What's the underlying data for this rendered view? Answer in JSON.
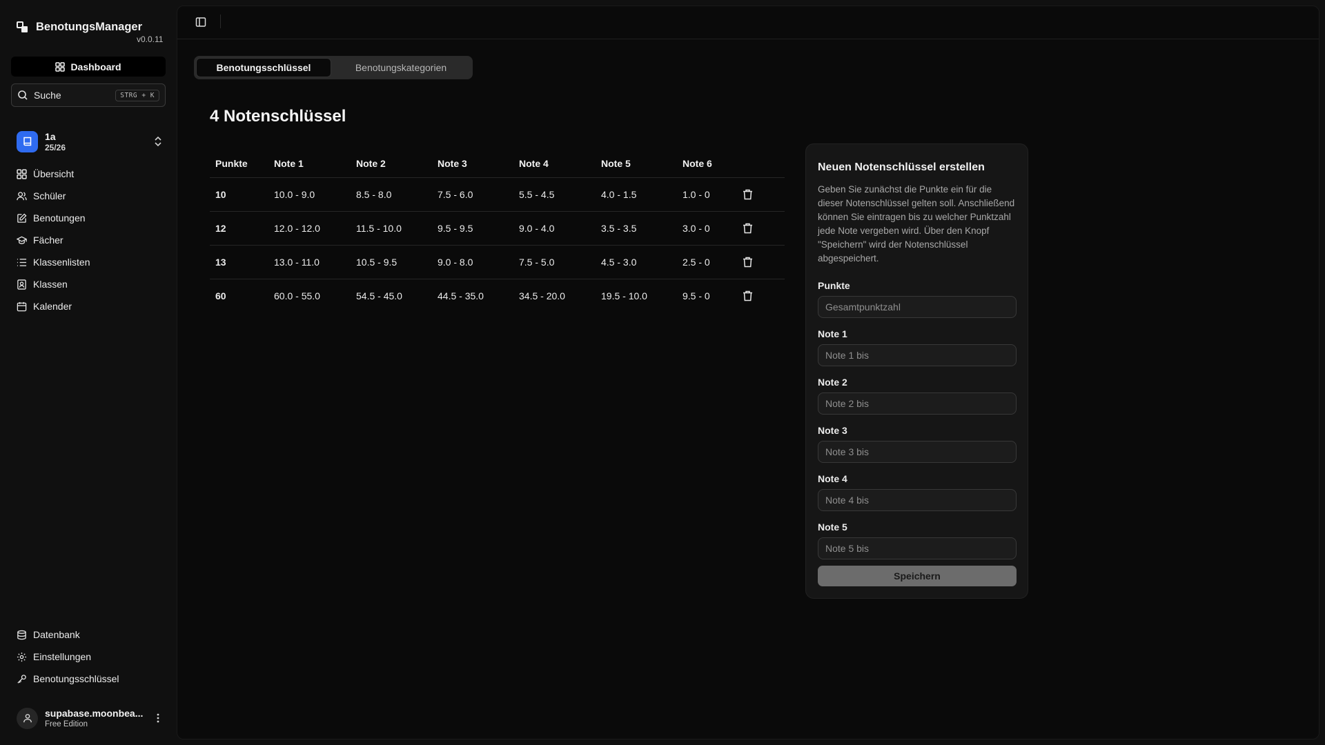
{
  "app": {
    "name": "BenotungsManager",
    "version": "v0.0.11"
  },
  "sidebar": {
    "dashboard_label": "Dashboard",
    "search": {
      "label": "Suche",
      "shortcut": "STRG + K"
    },
    "class": {
      "name": "1a",
      "year": "25/26"
    },
    "nav": [
      {
        "label": "Übersicht",
        "icon": "grid-icon"
      },
      {
        "label": "Schüler",
        "icon": "users-icon"
      },
      {
        "label": "Benotungen",
        "icon": "edit-icon"
      },
      {
        "label": "Fächer",
        "icon": "graduation-cap-icon"
      },
      {
        "label": "Klassenlisten",
        "icon": "list-icon"
      },
      {
        "label": "Klassen",
        "icon": "contact-icon"
      },
      {
        "label": "Kalender",
        "icon": "calendar-icon"
      }
    ],
    "nav_bottom": [
      {
        "label": "Datenbank",
        "icon": "database-icon"
      },
      {
        "label": "Einstellungen",
        "icon": "gear-icon"
      },
      {
        "label": "Benotungsschlüssel",
        "icon": "key-icon"
      }
    ],
    "user": {
      "name": "supabase.moonbea...",
      "plan": "Free Edition"
    }
  },
  "main": {
    "tabs": [
      {
        "label": "Benotungsschlüssel",
        "active": true
      },
      {
        "label": "Benotungskategorien",
        "active": false
      }
    ],
    "title": "4 Notenschlüssel",
    "table": {
      "headers": [
        "Punkte",
        "Note 1",
        "Note 2",
        "Note 3",
        "Note 4",
        "Note 5",
        "Note 6"
      ],
      "rows": [
        [
          "10",
          "10.0 - 9.0",
          "8.5 - 8.0",
          "7.5 - 6.0",
          "5.5 - 4.5",
          "4.0 - 1.5",
          "1.0 - 0"
        ],
        [
          "12",
          "12.0 - 12.0",
          "11.5 - 10.0",
          "9.5 - 9.5",
          "9.0 - 4.0",
          "3.5 - 3.5",
          "3.0 - 0"
        ],
        [
          "13",
          "13.0 - 11.0",
          "10.5 - 9.5",
          "9.0 - 8.0",
          "7.5 - 5.0",
          "4.5 - 3.0",
          "2.5 - 0"
        ],
        [
          "60",
          "60.0 - 55.0",
          "54.5 - 45.0",
          "44.5 - 35.0",
          "34.5 - 20.0",
          "19.5 - 10.0",
          "9.5 - 0"
        ]
      ]
    }
  },
  "form": {
    "title": "Neuen Notenschlüssel erstellen",
    "description": "Geben Sie zunächst die Punkte ein für die dieser Notenschlüssel gelten soll. Anschließend können Sie eintragen bis zu welcher Punktzahl jede Note vergeben wird. Über den Knopf \"Speichern\" wird der Notenschlüssel abgespeichert.",
    "fields": [
      {
        "label": "Punkte",
        "placeholder": "Gesamtpunktzahl",
        "value": ""
      },
      {
        "label": "Note 1",
        "placeholder": "Note 1 bis",
        "value": ""
      },
      {
        "label": "Note 2",
        "placeholder": "Note 2 bis",
        "value": ""
      },
      {
        "label": "Note 3",
        "placeholder": "Note 3 bis",
        "value": ""
      },
      {
        "label": "Note 4",
        "placeholder": "Note 4 bis",
        "value": ""
      },
      {
        "label": "Note 5",
        "placeholder": "Note 5 bis",
        "value": ""
      }
    ],
    "save_label": "Speichern"
  },
  "colors": {
    "accent_blue": "#2f6bf0",
    "background": "#101010",
    "panel": "#0a0a0a",
    "card": "#161616"
  }
}
